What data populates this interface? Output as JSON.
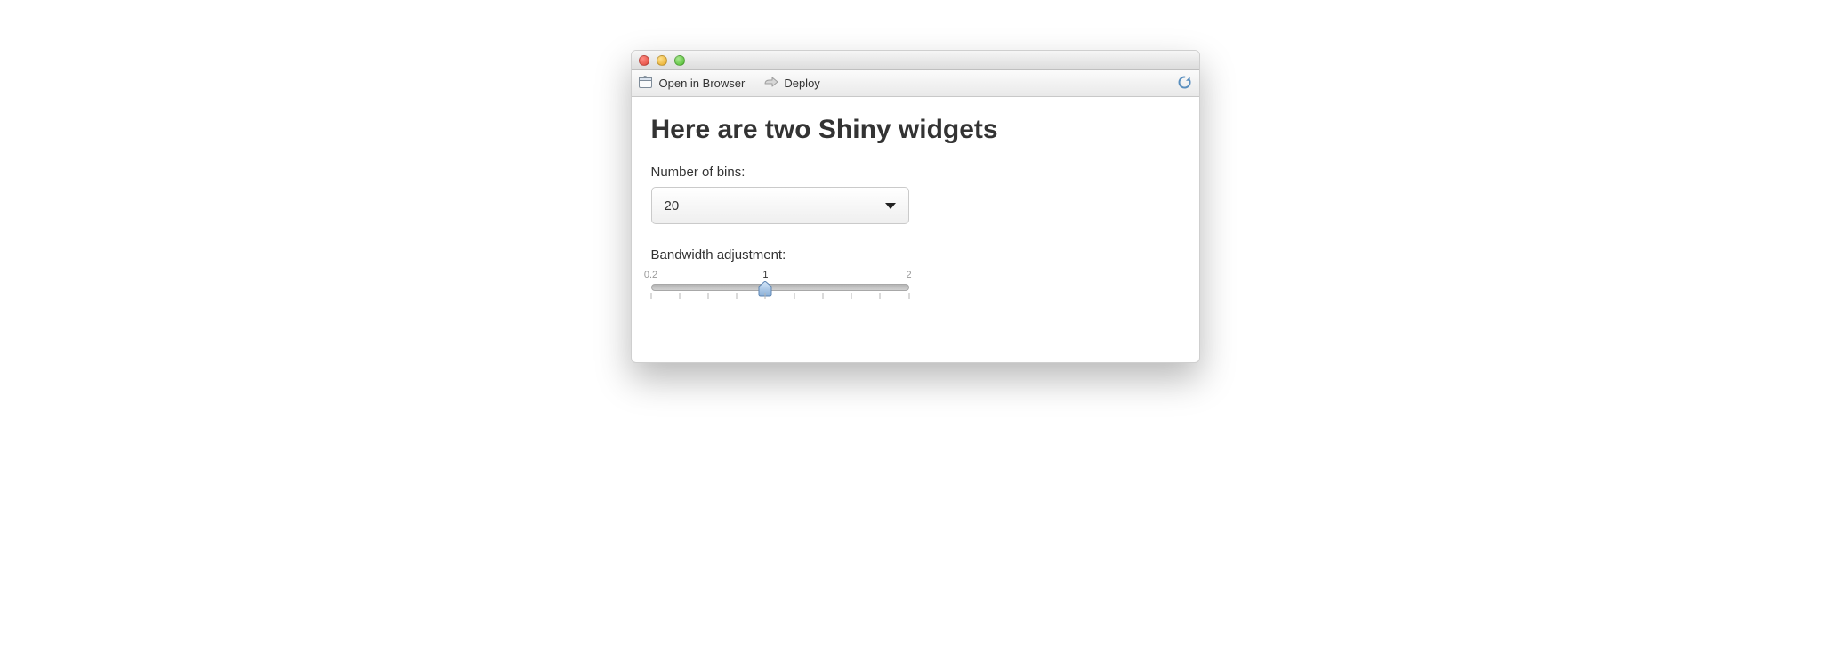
{
  "toolbar": {
    "open_in_browser_label": "Open in Browser",
    "deploy_label": "Deploy"
  },
  "page": {
    "title": "Here are two Shiny widgets"
  },
  "bins_widget": {
    "label": "Number of bins:",
    "selected_value": "20"
  },
  "bandwidth_widget": {
    "label": "Bandwidth adjustment:",
    "min": 0.2,
    "max": 2,
    "value": 1,
    "tick_labels": {
      "min": "0.2",
      "value": "1",
      "max": "2"
    },
    "minor_ticks_count": 10
  }
}
